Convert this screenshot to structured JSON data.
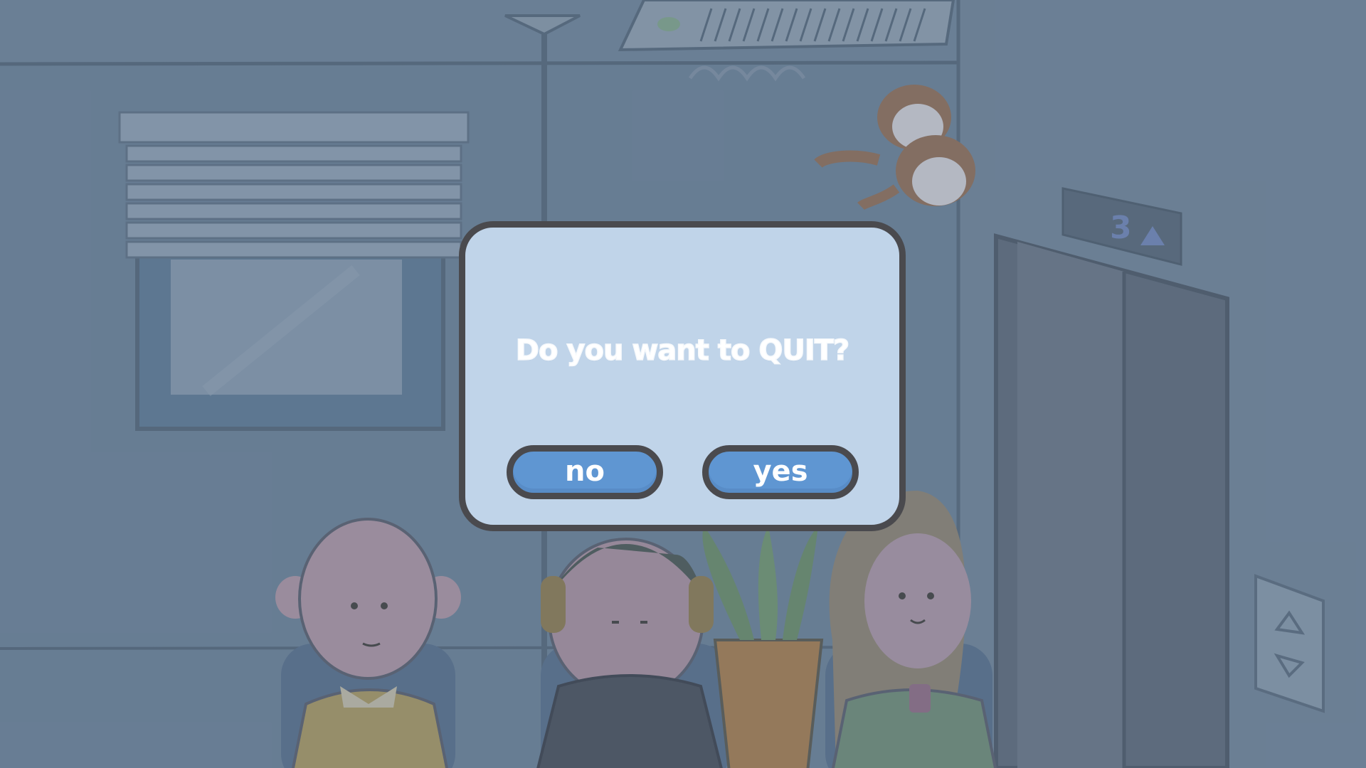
{
  "dialog": {
    "message": "Do you want to QUIT?",
    "no_label": "no",
    "yes_label": "yes"
  },
  "scene": {
    "elevator_floor_display": "3",
    "elevator_direction_icon": "up-arrow-icon"
  },
  "colors": {
    "dialog_background": "#c0d4e9",
    "dialog_border": "#4a4a4e",
    "button_fill": "#5f96d2",
    "text": "#ffffff",
    "scene_wall": "#6a7f95"
  }
}
